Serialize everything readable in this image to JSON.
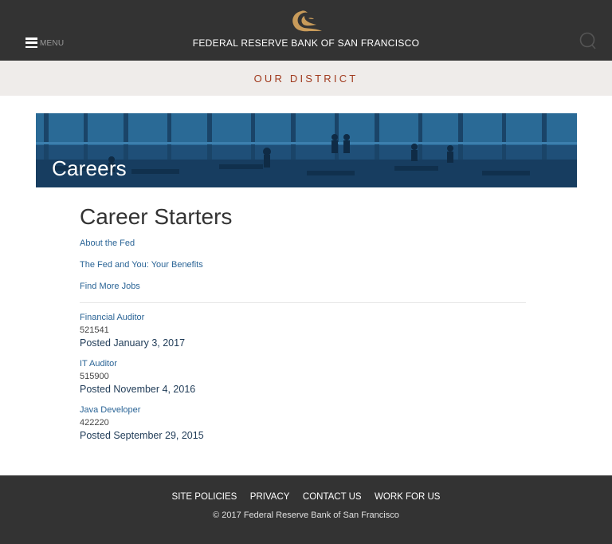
{
  "header": {
    "menu_label": "MENU",
    "bank_name": "FEDERAL RESERVE BANK OF SAN FRANCISCO"
  },
  "district_nav": {
    "label": "OUR DISTRICT"
  },
  "banner": {
    "title": "Careers"
  },
  "main": {
    "title": "Career Starters",
    "links": [
      {
        "label": "About the Fed"
      },
      {
        "label": "The Fed and You: Your Benefits"
      },
      {
        "label": "Find More Jobs"
      }
    ],
    "jobs": [
      {
        "title": "Financial Auditor",
        "id": "521541",
        "posted": "Posted January 3, 2017"
      },
      {
        "title": "IT Auditor",
        "id": "515900",
        "posted": "Posted November 4, 2016"
      },
      {
        "title": "Java Developer",
        "id": "422220",
        "posted": "Posted September 29, 2015"
      }
    ]
  },
  "footer": {
    "links": [
      {
        "label": "SITE POLICIES"
      },
      {
        "label": "PRIVACY"
      },
      {
        "label": "CONTACT US"
      },
      {
        "label": "WORK FOR US"
      }
    ],
    "copyright": "© 2017 Federal Reserve Bank of San Francisco"
  },
  "colors": {
    "header_bg": "#333333",
    "district_bg": "#efecea",
    "district_text": "#a03a1e",
    "link": "#2a6496",
    "logo": "#c89b5a"
  }
}
